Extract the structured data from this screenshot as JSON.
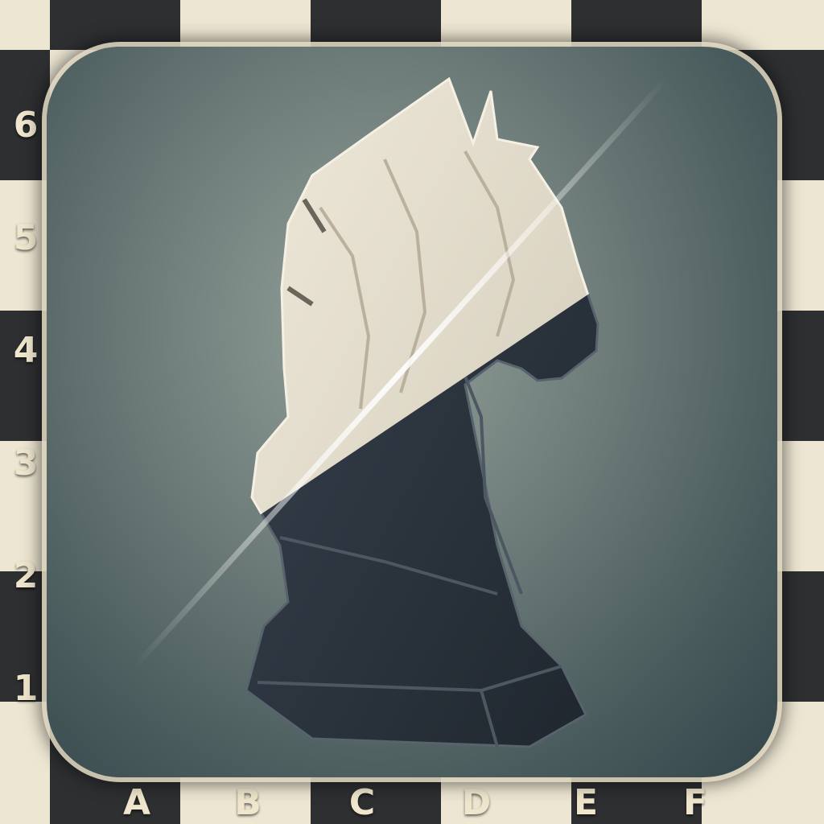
{
  "board": {
    "ranks": [
      "6",
      "5",
      "4",
      "3",
      "2",
      "1"
    ],
    "files": [
      "A",
      "B",
      "C",
      "D",
      "E",
      "F"
    ]
  },
  "colors": {
    "dark_square": "#2e2f31",
    "light_square": "#ede6d2",
    "label": "#efe6cd",
    "card_bg": "#5f6f6d",
    "knight_light": "#e3dccb",
    "knight_dark": "#27303a"
  },
  "icon": {
    "name": "knight-icon"
  }
}
